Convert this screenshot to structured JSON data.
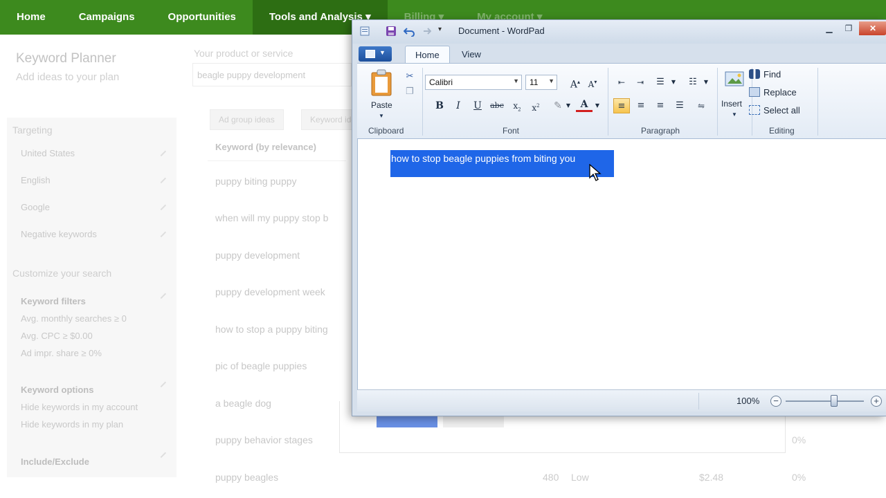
{
  "nav": {
    "items": [
      {
        "label": "Home"
      },
      {
        "label": "Campaigns"
      },
      {
        "label": "Opportunities"
      },
      {
        "label": "Tools and Analysis ▾"
      },
      {
        "label": "Billing ▾"
      },
      {
        "label": "My account ▾"
      }
    ]
  },
  "planner": {
    "title": "Keyword Planner",
    "subtitle": "Add ideas to your plan",
    "product_label": "Your product or service",
    "product_value": "beagle puppy development",
    "tabs": [
      "Ad group ideas",
      "Keyword ideas"
    ],
    "column_header": "Keyword (by relevance)",
    "keywords": [
      "puppy biting puppy",
      "when will my puppy stop b",
      "puppy development",
      "puppy development week",
      "how to stop a puppy biting",
      "pic of beagle puppies",
      "a beagle dog",
      "puppy behavior stages",
      "puppy beagles"
    ],
    "last_row": {
      "searches": "480",
      "competition": "Low",
      "bid": "$2.48",
      "share": "0%"
    },
    "share_prev": "0%"
  },
  "sidebar": {
    "targeting_label": "Targeting",
    "targeting": [
      "United States",
      "English",
      "Google",
      "Negative keywords"
    ],
    "customize_label": "Customize your search",
    "filters_title": "Keyword filters",
    "filters": [
      "Avg. monthly searches ≥ 0",
      "Avg. CPC ≥ $0.00",
      "Ad impr. share ≥ 0%"
    ],
    "options_title": "Keyword options",
    "options": [
      "Hide keywords in my account",
      "Hide keywords in my plan"
    ],
    "include_exclude": "Include/Exclude"
  },
  "wordpad": {
    "title": "Document - WordPad",
    "tabs": [
      "Home",
      "View"
    ],
    "clipboard": {
      "paste_label": "Paste",
      "group_label": "Clipboard"
    },
    "font": {
      "family": "Calibri",
      "size": "11",
      "group_label": "Font"
    },
    "paragraph": {
      "group_label": "Paragraph"
    },
    "insert": {
      "label": "Insert"
    },
    "editing": {
      "find": "Find",
      "replace": "Replace",
      "select_all": "Select all",
      "group_label": "Editing"
    },
    "document_text": "how to stop beagle puppies from biting you",
    "zoom": "100%",
    "zoom_level": 1.0
  },
  "colors": {
    "nav_green": "#3d8a1e",
    "selection_blue": "#1f66e8"
  }
}
